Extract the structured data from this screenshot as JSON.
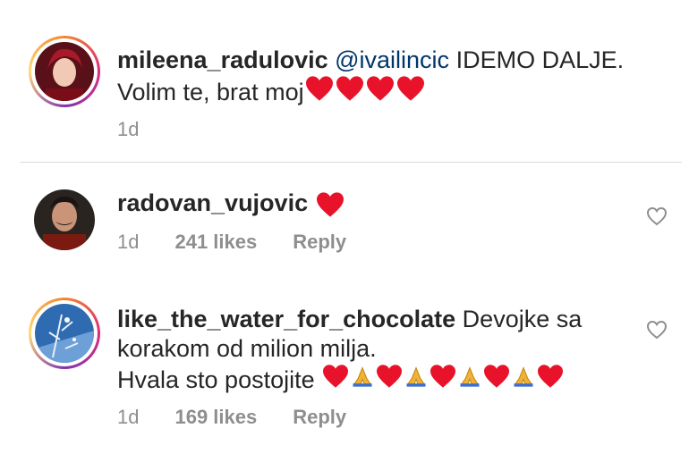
{
  "comments": [
    {
      "username": "mileena_radulovic",
      "mention": "@ivailincic",
      "line1_rest": " IDEMO DALJE.",
      "line2": "Volim te, brat moj",
      "time": "1d"
    },
    {
      "username": "radovan_vujovic",
      "time": "1d",
      "likes": "241 likes",
      "reply": "Reply"
    },
    {
      "username": "like_the_water_for_chocolate",
      "line1_rest": " Devojke sa",
      "line2": "korakom od milion milja.",
      "line3": "Hvala sto postojite",
      "time": "1d",
      "likes": "169 likes",
      "reply": "Reply"
    }
  ],
  "colors": {
    "heart": "#e8132b",
    "text": "#262626",
    "meta": "#8e8e8e",
    "mention": "#00376b"
  },
  "icons": {
    "like": "heart-outline-icon",
    "emoji_heart": "red-heart",
    "emoji_pray": "folded-hands"
  }
}
